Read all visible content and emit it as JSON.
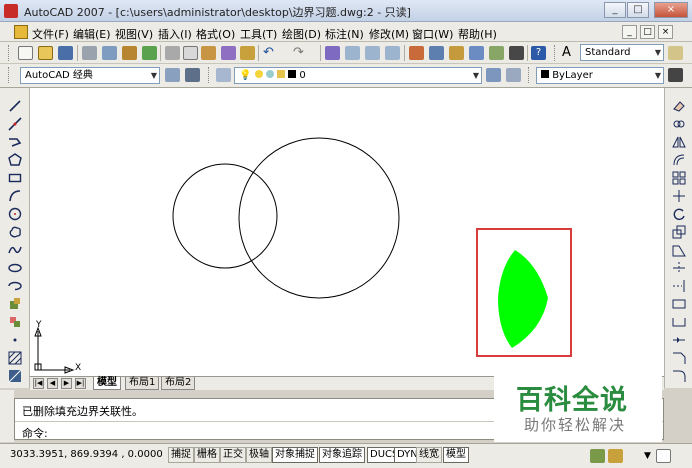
{
  "window": {
    "title": "AutoCAD 2007 - [c:\\users\\administrator\\desktop\\边界习题.dwg:2 - 只读]",
    "controls": [
      "_",
      "□",
      "×"
    ]
  },
  "menubar": {
    "items": [
      "文件(F)",
      "编辑(E)",
      "视图(V)",
      "插入(I)",
      "格式(O)",
      "工具(T)",
      "绘图(D)",
      "标注(N)",
      "修改(M)",
      "窗口(W)",
      "帮助(H)"
    ],
    "mdi_controls": [
      "_",
      "□",
      "×"
    ]
  },
  "toolbar": {
    "text_style": "Standard",
    "workspace": "AutoCAD 经典",
    "layer": "0",
    "color": "ByLayer"
  },
  "drawing": {
    "ucs_y": "Y",
    "ucs_x": "X"
  },
  "layout_tabs": {
    "nav": [
      "|◀",
      "◀",
      "▶",
      "▶|"
    ],
    "tabs": [
      "模型",
      "布局1",
      "布局2"
    ],
    "active": "模型"
  },
  "command": {
    "history": "已删除填充边界关联性。",
    "prompt": "命令:"
  },
  "status": {
    "coordinates": "3033.3951, 869.9394 , 0.0000",
    "toggles": [
      "捕捉",
      "栅格",
      "正交",
      "极轴",
      "对象捕捉",
      "对象追踪",
      "DUCS",
      "DYN",
      "线宽",
      "模型"
    ],
    "active_toggles": [
      "对象捕捉",
      "对象追踪",
      "DUCS",
      "DYN",
      "模型"
    ]
  },
  "watermark": {
    "main": "百科全说",
    "sub": "助你轻松解决"
  },
  "colors": {
    "fill": "#00ff00",
    "highlight_box": "#d93a3a",
    "watermark_green": "#2a8c3e"
  }
}
